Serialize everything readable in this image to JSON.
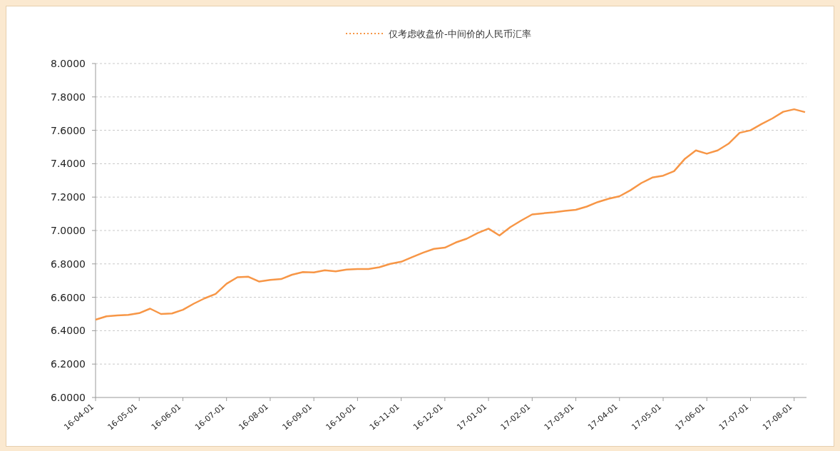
{
  "chart_data": {
    "type": "line",
    "grid": true,
    "categories": [
      "16-04-01",
      null,
      null,
      null,
      "16-05-01",
      null,
      null,
      null,
      "16-06-01",
      null,
      null,
      null,
      "16-07-01",
      null,
      null,
      null,
      "16-08-01",
      null,
      null,
      null,
      "16-09-01",
      null,
      null,
      null,
      "16-10-01",
      null,
      null,
      null,
      "16-11-01",
      null,
      null,
      null,
      "16-12-01",
      null,
      null,
      null,
      "17-01-01",
      null,
      null,
      null,
      "17-02-01",
      null,
      null,
      null,
      "17-03-01",
      null,
      null,
      null,
      "17-04-01",
      null,
      null,
      null,
      "17-05-01",
      null,
      null,
      null,
      "17-06-01",
      null,
      null,
      null,
      "17-07-01",
      null,
      null,
      null,
      "17-08-01",
      null
    ],
    "series": [
      {
        "name": "仅考虑收盘价-中间价的人民币汇率",
        "color": "#f79646",
        "values": [
          6.466,
          6.486,
          6.492,
          6.495,
          6.505,
          6.532,
          6.5,
          6.503,
          6.525,
          6.562,
          6.594,
          6.62,
          6.681,
          6.72,
          6.723,
          6.694,
          6.704,
          6.709,
          6.735,
          6.751,
          6.749,
          6.762,
          6.755,
          6.766,
          6.769,
          6.769,
          6.78,
          6.8,
          6.813,
          6.84,
          6.867,
          6.89,
          6.897,
          6.928,
          6.951,
          6.984,
          7.011,
          6.97,
          7.02,
          7.06,
          7.096,
          7.103,
          7.109,
          7.117,
          7.124,
          7.143,
          7.17,
          7.19,
          7.205,
          7.241,
          7.284,
          7.317,
          7.328,
          7.355,
          7.43,
          7.48,
          7.46,
          7.48,
          7.52,
          7.585,
          7.6,
          7.637,
          7.671,
          7.711,
          7.726,
          7.709
        ]
      }
    ],
    "ylim": [
      6,
      8
    ],
    "yticks": [
      {
        "value": 6,
        "label": "6.0000"
      },
      {
        "value": 6.2,
        "label": "6.2000"
      },
      {
        "value": 6.4,
        "label": "6.4000"
      },
      {
        "value": 6.6,
        "label": "6.6000"
      },
      {
        "value": 6.8,
        "label": "6.8000"
      },
      {
        "value": 7,
        "label": "7.0000"
      },
      {
        "value": 7.2,
        "label": "7.2000"
      },
      {
        "value": 7.4,
        "label": "7.4000"
      },
      {
        "value": 7.6,
        "label": "7.6000"
      },
      {
        "value": 7.8,
        "label": "7.8000"
      },
      {
        "value": 8,
        "label": "8.0000"
      }
    ]
  }
}
